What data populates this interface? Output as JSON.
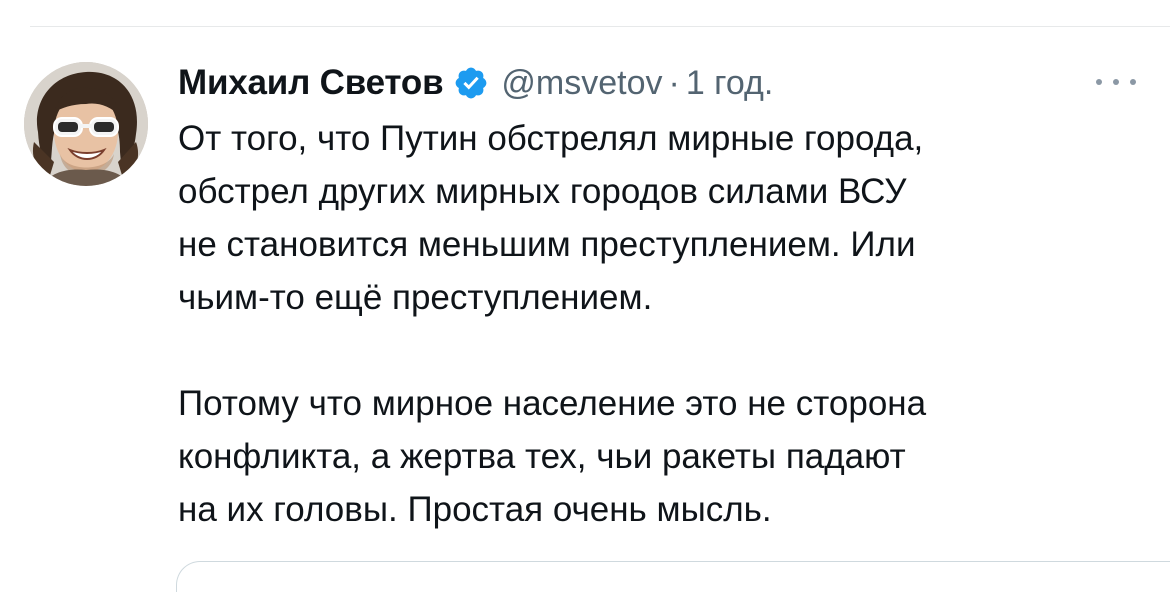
{
  "tweet": {
    "author": {
      "display_name": "Михаил Светов",
      "handle": "@msvetov",
      "verified": true,
      "verified_icon": "verified-badge-icon",
      "avatar_icon": "avatar-photo"
    },
    "separator": "·",
    "time": "1 год.",
    "more_icon": "more-options-icon",
    "paragraphs": [
      "От того, что Путин обстрелял мирные города,\nобстрел других мирных городов силами ВСУ\nне становится меньшим преступлением. Или\nчьим-то ещё преступлением.",
      "Потому что мирное население это не сторона\nконфликта, а жертва тех, чьи ракеты падают\nна их головы. Простая очень мысль."
    ]
  },
  "colors": {
    "text": "#0f1419",
    "secondary_text": "#536471",
    "verified_blue": "#1d9bf0",
    "divider": "#e7e9ea"
  }
}
